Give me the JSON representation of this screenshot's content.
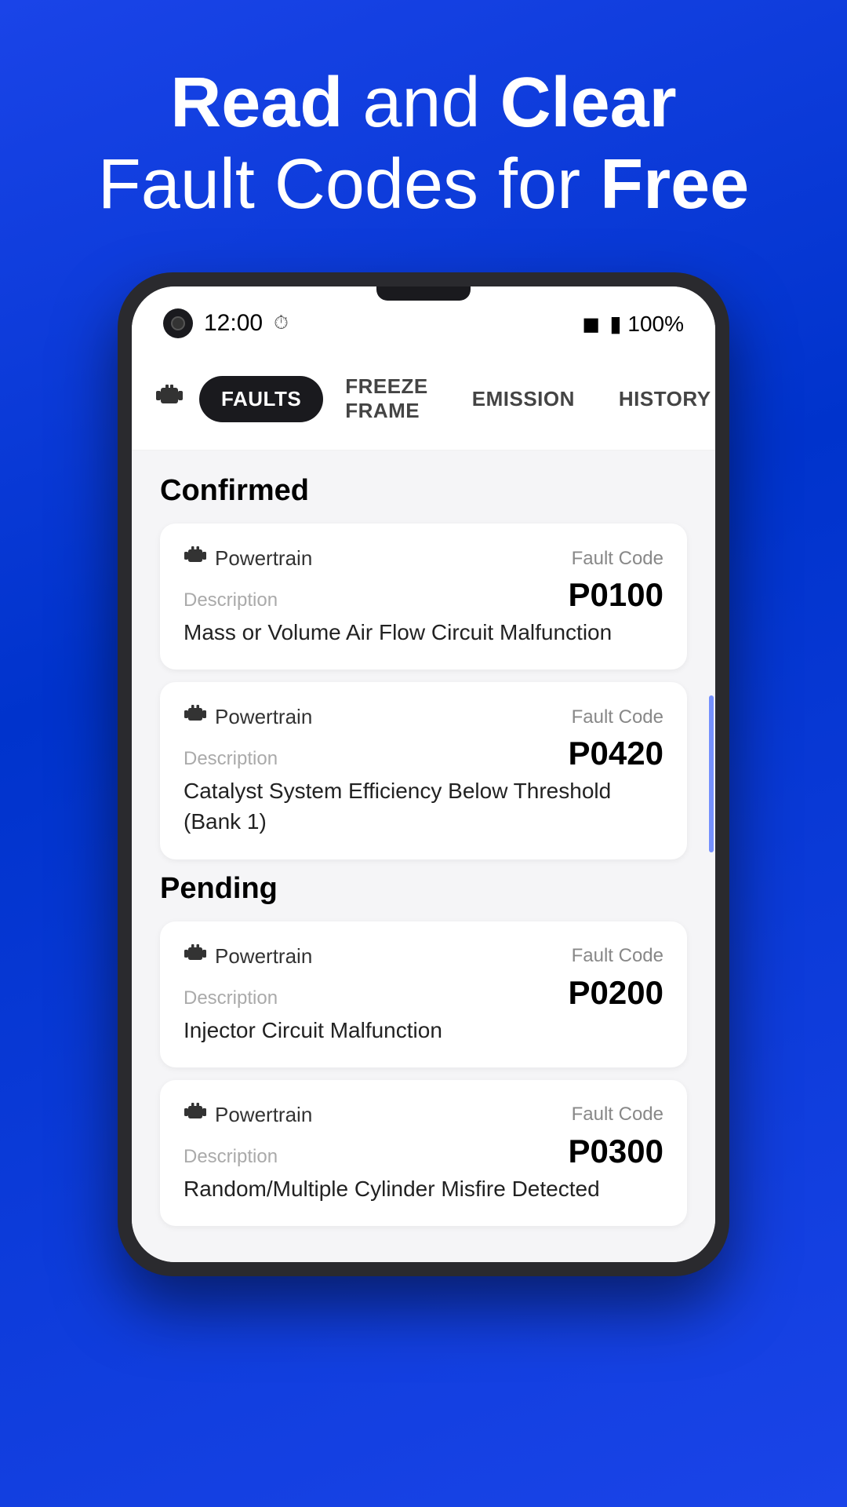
{
  "hero": {
    "line1_normal": "and",
    "line1_bold1": "Read",
    "line1_bold2": "Clear",
    "line2_normal": "Fault Codes for",
    "line2_bold": "Free"
  },
  "status_bar": {
    "time": "12:00",
    "battery": "100%"
  },
  "nav": {
    "tabs": [
      {
        "id": "faults",
        "label": "Faults",
        "active": true
      },
      {
        "id": "freeze-frame",
        "label": "Freeze Frame",
        "active": false
      },
      {
        "id": "emission",
        "label": "Emission",
        "active": false
      },
      {
        "id": "history",
        "label": "History",
        "active": false
      }
    ]
  },
  "confirmed_section": {
    "title": "Confirmed",
    "cards": [
      {
        "system": "Powertrain",
        "fault_code_label": "Fault Code",
        "description_label": "Description",
        "fault_code": "P0100",
        "description": "Mass or Volume Air Flow Circuit Malfunction"
      },
      {
        "system": "Powertrain",
        "fault_code_label": "Fault Code",
        "description_label": "Description",
        "fault_code": "P0420",
        "description": "Catalyst System Efficiency Below Threshold (Bank 1)"
      }
    ]
  },
  "pending_section": {
    "title": "Pending",
    "cards": [
      {
        "system": "Powertrain",
        "fault_code_label": "Fault Code",
        "description_label": "Description",
        "fault_code": "P0200",
        "description": "Injector Circuit Malfunction"
      },
      {
        "system": "Powertrain",
        "fault_code_label": "Fault Code",
        "description_label": "Description",
        "fault_code": "P0300",
        "description": "Random/Multiple Cylinder Misfire Detected"
      }
    ]
  },
  "icons": {
    "engine": "🔧",
    "wifi": "▾",
    "battery": "🔋"
  }
}
